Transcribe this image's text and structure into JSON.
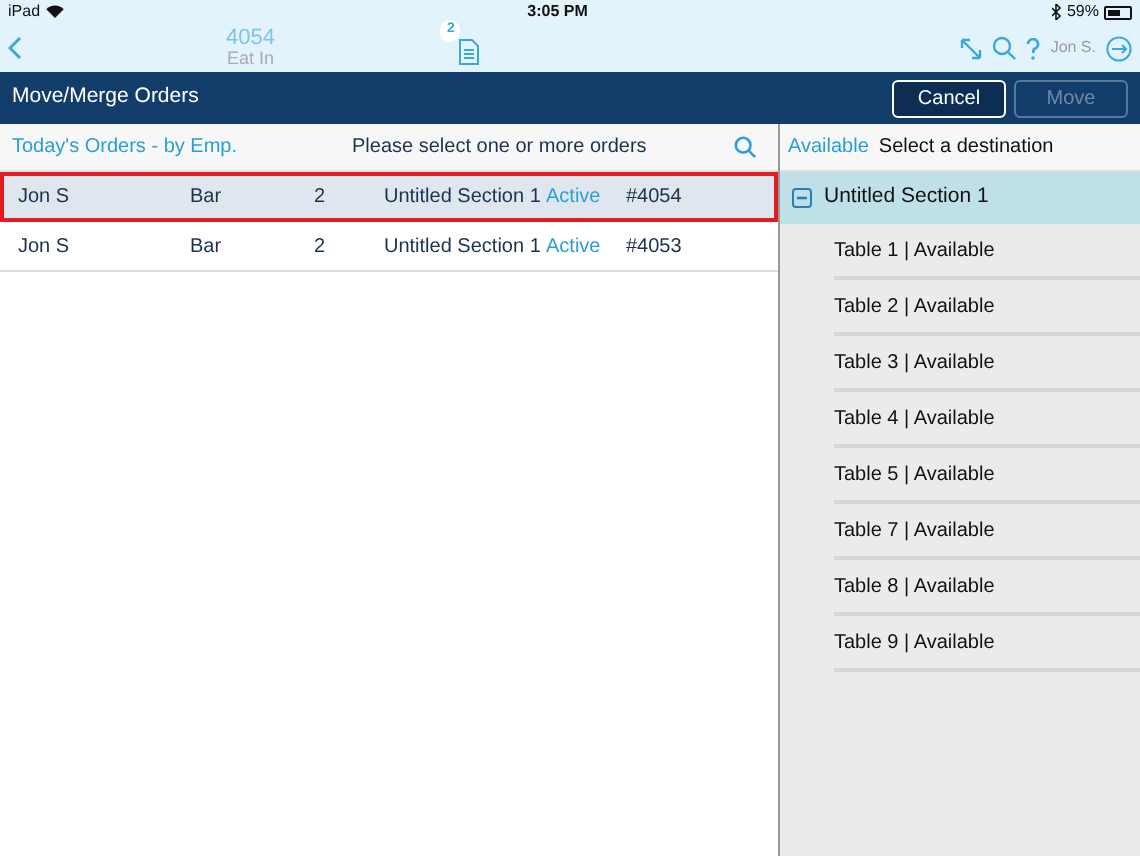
{
  "status_bar": {
    "device": "iPad",
    "time": "3:05 PM",
    "battery": "59%"
  },
  "header": {
    "order_number": "4054",
    "order_type": "Eat In",
    "ticket_count": "2",
    "user": "Jon S."
  },
  "dialog": {
    "title": "Move/Merge Orders",
    "buttons": [
      {
        "label": "Cancel",
        "disabled": false
      },
      {
        "label": "Move",
        "disabled": true
      }
    ]
  },
  "orders_panel": {
    "filter": "Today's Orders - by Emp.",
    "prompt": "Please select one or more orders",
    "rows": [
      {
        "employee": "Jon S",
        "area": "Bar",
        "guests": "2",
        "section": "Untitled Section 1",
        "status": "Active",
        "number": "#4054",
        "selected": true
      },
      {
        "employee": "Jon S",
        "area": "Bar",
        "guests": "2",
        "section": "Untitled Section 1",
        "status": "Active",
        "number": "#4053",
        "selected": false
      }
    ]
  },
  "destination_panel": {
    "filter": "Available",
    "prompt": "Select a destination",
    "sections": [
      {
        "label": "Untitled Section 1",
        "expanded": true,
        "children": [
          {
            "label": "Table 1 | Available"
          },
          {
            "label": "Table 2 | Available"
          },
          {
            "label": "Table 3 | Available"
          },
          {
            "label": "Table 4 | Available"
          },
          {
            "label": "Table 5 | Available"
          },
          {
            "label": "Table 7 | Available"
          },
          {
            "label": "Table 8 | Available"
          },
          {
            "label": "Table 9 | Available"
          }
        ]
      }
    ]
  }
}
